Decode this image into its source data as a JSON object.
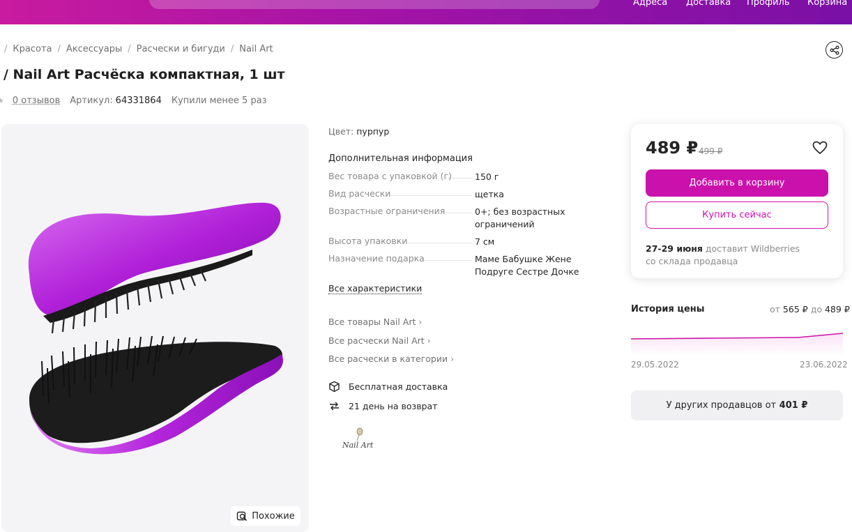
{
  "header": {
    "nav": [
      "Адреса",
      "Доставка",
      "Профиль",
      "Корзина"
    ]
  },
  "breadcrumbs": [
    "Красота",
    "Аксессуары",
    "Расчески и бигуди",
    "Nail Art"
  ],
  "product": {
    "title": "/ Nail Art Расчёска компактная, 1 шт",
    "reviews": "0 отзывов",
    "article_label": "Артикул:",
    "article_value": "64331864",
    "bought": "Купили менее 5 раз"
  },
  "gallery": {
    "similar_label": "Похожие"
  },
  "details": {
    "color_label": "Цвет:",
    "color_value": "пурпур",
    "info_heading": "Дополнительная информация",
    "specs": [
      {
        "key": "Вес товара с упаковкой (г)",
        "value": "150 г"
      },
      {
        "key": "Вид расчески",
        "value": "щетка"
      },
      {
        "key": "Возрастные ограничения",
        "value": "0+; без возрастных ограничений"
      },
      {
        "key": "Высота упаковки",
        "value": "7 см"
      },
      {
        "key": "Назначение подарка",
        "value": "Маме Бабушке Жене Подруге Сестре Дочке"
      }
    ],
    "all_specs": "Все характеристики",
    "links": [
      "Все товары Nail Art",
      "Все расчески Nail Art",
      "Все расчески в категории"
    ],
    "features": [
      "Бесплатная доставка",
      "21 день на возврат"
    ],
    "brand_logo_text": "Nail Art"
  },
  "price_card": {
    "price": "489 ₽",
    "old_price": "499 ₽",
    "add_to_cart": "Добавить в корзину",
    "buy_now": "Купить сейчас",
    "delivery_date": "27-29 июня",
    "delivery_by": "доставит Wildberries",
    "delivery_from": "со склада продавца"
  },
  "price_history": {
    "title": "История цены",
    "from_label": "от",
    "from_value": "565 ₽",
    "to_label": "до",
    "to_value": "489 ₽",
    "date_start": "29.05.2022",
    "date_end": "23.06.2022"
  },
  "other_sellers": {
    "label": "У других продавцов от",
    "price": "401 ₽"
  },
  "colors": {
    "accent": "#cb11ab",
    "header_start": "#c81ba0",
    "header_end": "#7a10a6"
  }
}
